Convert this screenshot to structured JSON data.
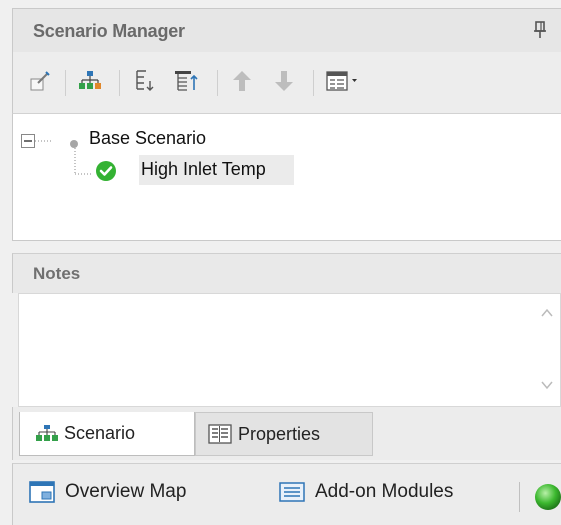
{
  "panel": {
    "title": "Scenario Manager"
  },
  "toolbar": {
    "buttons": [
      {
        "icon": "new-scenario-icon"
      },
      {
        "icon": "scenario-tree-icon"
      },
      {
        "icon": "collapse-tree-icon"
      },
      {
        "icon": "expand-tree-icon"
      },
      {
        "icon": "move-up-icon"
      },
      {
        "icon": "move-down-icon"
      },
      {
        "icon": "view-options-icon"
      }
    ]
  },
  "tree": {
    "root": {
      "label": "Base Scenario"
    },
    "child": {
      "label": "High Inlet Temp",
      "status": "ok"
    }
  },
  "notes": {
    "header": "Notes",
    "value": ""
  },
  "tabs": [
    {
      "label": "Scenario",
      "active": true
    },
    {
      "label": "Properties",
      "active": false
    }
  ],
  "bottombar": {
    "items": [
      {
        "label": "Overview Map"
      },
      {
        "label": "Add-on Modules"
      }
    ]
  },
  "colors": {
    "accent_green": "#34b233",
    "icon_blue": "#2e75b6",
    "icon_orange": "#e0872b"
  }
}
